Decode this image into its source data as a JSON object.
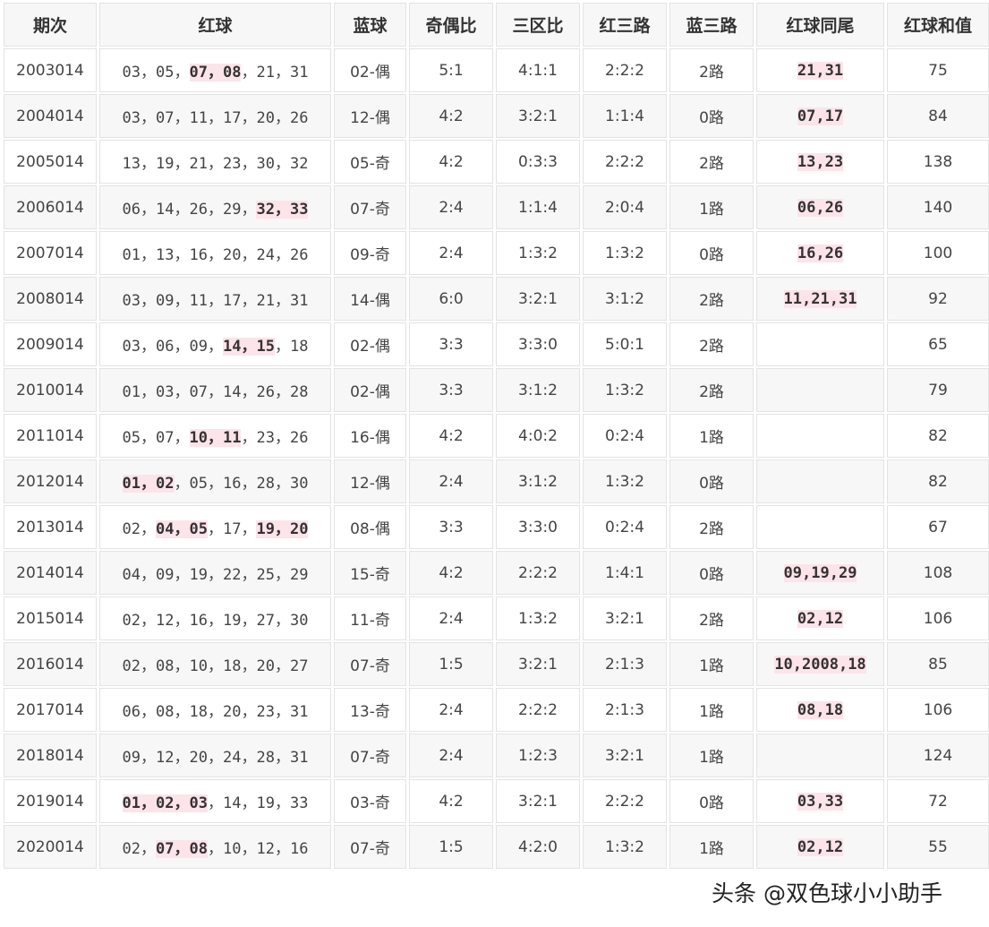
{
  "columns": [
    "期次",
    "红球",
    "蓝球",
    "奇偶比",
    "三区比",
    "红三路",
    "蓝三路",
    "红球同尾",
    "红球和值"
  ],
  "rows": [
    {
      "issue": "2003014",
      "red": [
        {
          "t": "03",
          "h": false
        },
        {
          "t": "05",
          "h": false
        },
        {
          "t": "07",
          "h": true
        },
        {
          "t": "08",
          "h": true
        },
        {
          "t": "21",
          "h": false
        },
        {
          "t": "31",
          "h": false
        }
      ],
      "blue": "02-偶",
      "odd_even": "5:1",
      "zone": "4:1:1",
      "red_route": "2:2:2",
      "blue_route": "2路",
      "tail": "21,31",
      "sum": "75"
    },
    {
      "issue": "2004014",
      "red": [
        {
          "t": "03",
          "h": false
        },
        {
          "t": "07",
          "h": false
        },
        {
          "t": "11",
          "h": false
        },
        {
          "t": "17",
          "h": false
        },
        {
          "t": "20",
          "h": false
        },
        {
          "t": "26",
          "h": false
        }
      ],
      "blue": "12-偶",
      "odd_even": "4:2",
      "zone": "3:2:1",
      "red_route": "1:1:4",
      "blue_route": "0路",
      "tail": "07,17",
      "sum": "84"
    },
    {
      "issue": "2005014",
      "red": [
        {
          "t": "13",
          "h": false
        },
        {
          "t": "19",
          "h": false
        },
        {
          "t": "21",
          "h": false
        },
        {
          "t": "23",
          "h": false
        },
        {
          "t": "30",
          "h": false
        },
        {
          "t": "32",
          "h": false
        }
      ],
      "blue": "05-奇",
      "odd_even": "4:2",
      "zone": "0:3:3",
      "red_route": "2:2:2",
      "blue_route": "2路",
      "tail": "13,23",
      "sum": "138"
    },
    {
      "issue": "2006014",
      "red": [
        {
          "t": "06",
          "h": false
        },
        {
          "t": "14",
          "h": false
        },
        {
          "t": "26",
          "h": false
        },
        {
          "t": "29",
          "h": false
        },
        {
          "t": "32",
          "h": true
        },
        {
          "t": "33",
          "h": true
        }
      ],
      "blue": "07-奇",
      "odd_even": "2:4",
      "zone": "1:1:4",
      "red_route": "2:0:4",
      "blue_route": "1路",
      "tail": "06,26",
      "sum": "140"
    },
    {
      "issue": "2007014",
      "red": [
        {
          "t": "01",
          "h": false
        },
        {
          "t": "13",
          "h": false
        },
        {
          "t": "16",
          "h": false
        },
        {
          "t": "20",
          "h": false
        },
        {
          "t": "24",
          "h": false
        },
        {
          "t": "26",
          "h": false
        }
      ],
      "blue": "09-奇",
      "odd_even": "2:4",
      "zone": "1:3:2",
      "red_route": "1:3:2",
      "blue_route": "0路",
      "tail": "16,26",
      "sum": "100"
    },
    {
      "issue": "2008014",
      "red": [
        {
          "t": "03",
          "h": false
        },
        {
          "t": "09",
          "h": false
        },
        {
          "t": "11",
          "h": false
        },
        {
          "t": "17",
          "h": false
        },
        {
          "t": "21",
          "h": false
        },
        {
          "t": "31",
          "h": false
        }
      ],
      "blue": "14-偶",
      "odd_even": "6:0",
      "zone": "3:2:1",
      "red_route": "3:1:2",
      "blue_route": "2路",
      "tail": "11,21,31",
      "sum": "92"
    },
    {
      "issue": "2009014",
      "red": [
        {
          "t": "03",
          "h": false
        },
        {
          "t": "06",
          "h": false
        },
        {
          "t": "09",
          "h": false
        },
        {
          "t": "14",
          "h": true
        },
        {
          "t": "15",
          "h": true
        },
        {
          "t": "18",
          "h": false
        }
      ],
      "blue": "02-偶",
      "odd_even": "3:3",
      "zone": "3:3:0",
      "red_route": "5:0:1",
      "blue_route": "2路",
      "tail": "",
      "sum": "65"
    },
    {
      "issue": "2010014",
      "red": [
        {
          "t": "01",
          "h": false
        },
        {
          "t": "03",
          "h": false
        },
        {
          "t": "07",
          "h": false
        },
        {
          "t": "14",
          "h": false
        },
        {
          "t": "26",
          "h": false
        },
        {
          "t": "28",
          "h": false
        }
      ],
      "blue": "02-偶",
      "odd_even": "3:3",
      "zone": "3:1:2",
      "red_route": "1:3:2",
      "blue_route": "2路",
      "tail": "",
      "sum": "79"
    },
    {
      "issue": "2011014",
      "red": [
        {
          "t": "05",
          "h": false
        },
        {
          "t": "07",
          "h": false
        },
        {
          "t": "10",
          "h": true
        },
        {
          "t": "11",
          "h": true
        },
        {
          "t": "23",
          "h": false
        },
        {
          "t": "26",
          "h": false
        }
      ],
      "blue": "16-偶",
      "odd_even": "4:2",
      "zone": "4:0:2",
      "red_route": "0:2:4",
      "blue_route": "1路",
      "tail": "",
      "sum": "82"
    },
    {
      "issue": "2012014",
      "red": [
        {
          "t": "01",
          "h": true
        },
        {
          "t": "02",
          "h": true
        },
        {
          "t": "05",
          "h": false
        },
        {
          "t": "16",
          "h": false
        },
        {
          "t": "28",
          "h": false
        },
        {
          "t": "30",
          "h": false
        }
      ],
      "blue": "12-偶",
      "odd_even": "2:4",
      "zone": "3:1:2",
      "red_route": "1:3:2",
      "blue_route": "0路",
      "tail": "",
      "sum": "82"
    },
    {
      "issue": "2013014",
      "red": [
        {
          "t": "02",
          "h": false
        },
        {
          "t": "04",
          "h": true
        },
        {
          "t": "05",
          "h": true
        },
        {
          "t": "17",
          "h": false
        },
        {
          "t": "19",
          "h": true
        },
        {
          "t": "20",
          "h": true
        }
      ],
      "blue": "08-偶",
      "odd_even": "3:3",
      "zone": "3:3:0",
      "red_route": "0:2:4",
      "blue_route": "2路",
      "tail": "",
      "sum": "67"
    },
    {
      "issue": "2014014",
      "red": [
        {
          "t": "04",
          "h": false
        },
        {
          "t": "09",
          "h": false
        },
        {
          "t": "19",
          "h": false
        },
        {
          "t": "22",
          "h": false
        },
        {
          "t": "25",
          "h": false
        },
        {
          "t": "29",
          "h": false
        }
      ],
      "blue": "15-奇",
      "odd_even": "4:2",
      "zone": "2:2:2",
      "red_route": "1:4:1",
      "blue_route": "0路",
      "tail": "09,19,29",
      "sum": "108"
    },
    {
      "issue": "2015014",
      "red": [
        {
          "t": "02",
          "h": false
        },
        {
          "t": "12",
          "h": false
        },
        {
          "t": "16",
          "h": false
        },
        {
          "t": "19",
          "h": false
        },
        {
          "t": "27",
          "h": false
        },
        {
          "t": "30",
          "h": false
        }
      ],
      "blue": "11-奇",
      "odd_even": "2:4",
      "zone": "1:3:2",
      "red_route": "3:2:1",
      "blue_route": "2路",
      "tail": "02,12",
      "sum": "106"
    },
    {
      "issue": "2016014",
      "red": [
        {
          "t": "02",
          "h": false
        },
        {
          "t": "08",
          "h": false
        },
        {
          "t": "10",
          "h": false
        },
        {
          "t": "18",
          "h": false
        },
        {
          "t": "20",
          "h": false
        },
        {
          "t": "27",
          "h": false
        }
      ],
      "blue": "07-奇",
      "odd_even": "1:5",
      "zone": "3:2:1",
      "red_route": "2:1:3",
      "blue_route": "1路",
      "tail": "10,2008,18",
      "sum": "85"
    },
    {
      "issue": "2017014",
      "red": [
        {
          "t": "06",
          "h": false
        },
        {
          "t": "08",
          "h": false
        },
        {
          "t": "18",
          "h": false
        },
        {
          "t": "20",
          "h": false
        },
        {
          "t": "23",
          "h": false
        },
        {
          "t": "31",
          "h": false
        }
      ],
      "blue": "13-奇",
      "odd_even": "2:4",
      "zone": "2:2:2",
      "red_route": "2:1:3",
      "blue_route": "1路",
      "tail": "08,18",
      "sum": "106"
    },
    {
      "issue": "2018014",
      "red": [
        {
          "t": "09",
          "h": false
        },
        {
          "t": "12",
          "h": false
        },
        {
          "t": "20",
          "h": false
        },
        {
          "t": "24",
          "h": false
        },
        {
          "t": "28",
          "h": false
        },
        {
          "t": "31",
          "h": false
        }
      ],
      "blue": "07-奇",
      "odd_even": "2:4",
      "zone": "1:2:3",
      "red_route": "3:2:1",
      "blue_route": "1路",
      "tail": "",
      "sum": "124"
    },
    {
      "issue": "2019014",
      "red": [
        {
          "t": "01",
          "h": true
        },
        {
          "t": "02",
          "h": true
        },
        {
          "t": "03",
          "h": true
        },
        {
          "t": "14",
          "h": false
        },
        {
          "t": "19",
          "h": false
        },
        {
          "t": "33",
          "h": false
        }
      ],
      "blue": "03-奇",
      "odd_even": "4:2",
      "zone": "3:2:1",
      "red_route": "2:2:2",
      "blue_route": "0路",
      "tail": "03,33",
      "sum": "72"
    },
    {
      "issue": "2020014",
      "red": [
        {
          "t": "02",
          "h": false
        },
        {
          "t": "07",
          "h": true
        },
        {
          "t": "08",
          "h": true
        },
        {
          "t": "10",
          "h": false
        },
        {
          "t": "12",
          "h": false
        },
        {
          "t": "16",
          "h": false
        }
      ],
      "blue": "07-奇",
      "odd_even": "1:5",
      "zone": "4:2:0",
      "red_route": "1:3:2",
      "blue_route": "1路",
      "tail": "02,12",
      "sum": "55"
    }
  ],
  "footer": "头条 @双色球小小助手",
  "colors": {
    "highlight": "#fde3ea",
    "border": "#e3e3e3",
    "header_bg": "#f7f7f7"
  }
}
